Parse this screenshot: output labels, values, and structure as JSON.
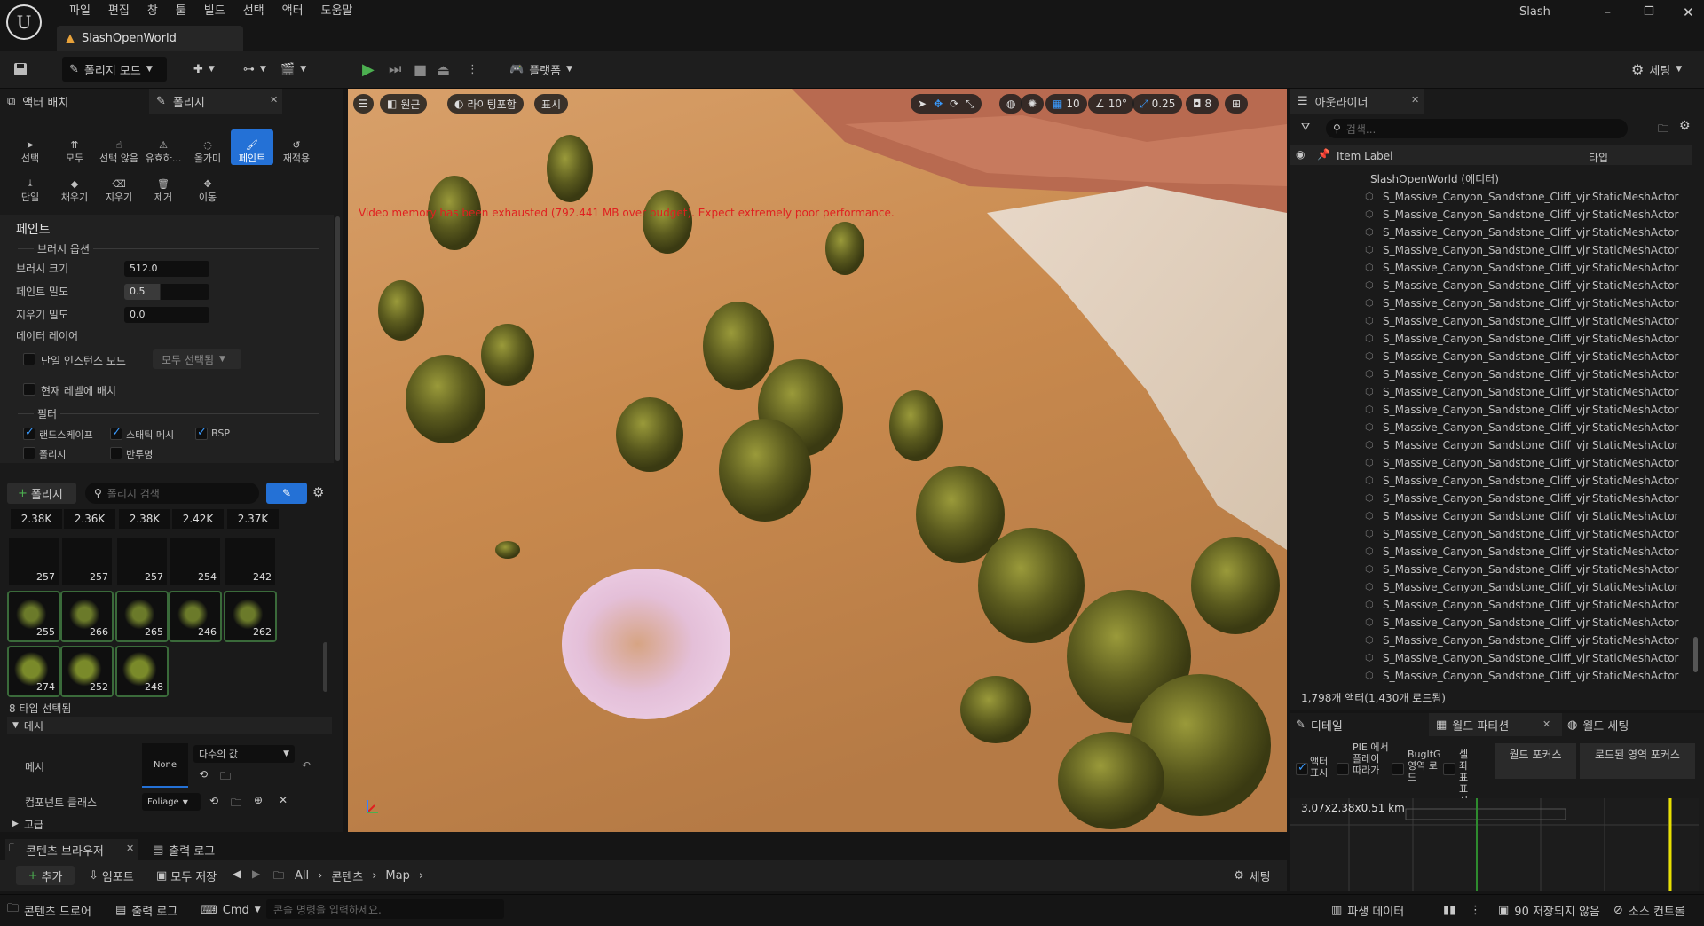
{
  "window": {
    "project_name": "Slash",
    "tab_title": "SlashOpenWorld"
  },
  "menu": [
    "파일",
    "편집",
    "창",
    "툴",
    "빌드",
    "선택",
    "액터",
    "도움말"
  ],
  "toolbar": {
    "mode_label": "폴리지 모드",
    "platform_label": "플랫폼",
    "settings_label": "세팅"
  },
  "left_panel": {
    "tabs": {
      "place_actors": "액터 배치",
      "foliage": "폴리지"
    },
    "tools": [
      "선택",
      "모두",
      "선택 않음",
      "유효하...",
      "올가미",
      "페인트",
      "재적용",
      "단일",
      "채우기",
      "지우기",
      "제거",
      "이동"
    ],
    "section_title": "페인트",
    "brush_options_label": "브러시 옵션",
    "brush_size_label": "브러시 크기",
    "brush_size": "512.0",
    "paint_density_label": "페인트 밀도",
    "paint_density": "0.5",
    "erase_density_label": "지우기 밀도",
    "erase_density": "0.0",
    "data_layer_label": "데이터 레이어",
    "single_instance_label": "단일 인스턴스 모드",
    "all_selected_label": "모두 선택됨",
    "place_current_level_label": "현재 레벨에 배치",
    "filter_label": "필터",
    "filters": {
      "landscape": "랜드스케이프",
      "static_mesh": "스태틱 메시",
      "bsp": "BSP",
      "foliage": "폴리지",
      "translucent": "반투명"
    },
    "add_foliage_label": "폴리지",
    "foliage_search_placeholder": "폴리지 검색",
    "counts": [
      "2.38K",
      "2.36K",
      "2.38K",
      "2.42K",
      "2.37K"
    ],
    "thumbs_row1": [
      "257",
      "257",
      "257",
      "254",
      "242"
    ],
    "thumbs_row2": [
      "255",
      "266",
      "265",
      "246",
      "262"
    ],
    "thumbs_row3": [
      "274",
      "252",
      "248"
    ],
    "types_selected": "8 타입 선택됨",
    "mesh_section": "메시",
    "mesh_label": "메시",
    "mesh_value": "None",
    "multiple_values": "다수의 값",
    "component_class_label": "컴포넌트 클래스",
    "component_class_value": "Foliage",
    "advanced_label": "고급"
  },
  "viewport": {
    "perspective": "원근",
    "lit": "라이팅포함",
    "show": "표시",
    "grid_snap": "10",
    "rot_snap": "10°",
    "scale_snap": "0.25",
    "camera_speed": "8",
    "warning": "Video memory has been exhausted (792.441 MB over budget). Expect extremely poor performance."
  },
  "outliner": {
    "tab": "아웃라이너",
    "search_placeholder": "검색...",
    "col_label": "Item Label",
    "col_type": "타입",
    "root": "SlashOpenWorld (에디터)",
    "item_name": "S_Massive_Canyon_Sandstone_Cliff_vjr",
    "item_type": "StaticMeshActor",
    "footer": "1,798개 액터(1,430개 로드됨)"
  },
  "details": {
    "tab_details": "디테일",
    "tab_world_partition": "월드 파티션",
    "tab_world_settings": "월드 세팅",
    "actor_display": "액터 표시",
    "pie_follow": "PIE 에서 플레이 따라가",
    "bug_region": "BugItG 영역 로드",
    "cell_coords": "셀 좌표 표시",
    "world_focus": "월드 포커스",
    "loaded_focus": "로드된 영역 포커스",
    "size": "3.07x2.38x0.51 km"
  },
  "bottom": {
    "content_browser_tab": "콘텐츠 브라우저",
    "output_log_tab": "출력 로그",
    "add": "추가",
    "import": "임포트",
    "save_all": "모두 저장",
    "path": [
      "All",
      "콘텐츠",
      "Map"
    ],
    "settings": "세팅"
  },
  "status": {
    "content_drawer": "콘텐츠 드로어",
    "output_log": "출력 로그",
    "cmd": "Cmd",
    "console_placeholder": "콘솔 명령을 입력하세요.",
    "derived_data": "파생 데이터",
    "unsaved": "90 저장되지 않음",
    "source_control": "소스 컨트롤"
  },
  "colors": {
    "accent": "#2471d6",
    "warning_red": "#e02020",
    "panel": "#1a1a1a"
  }
}
